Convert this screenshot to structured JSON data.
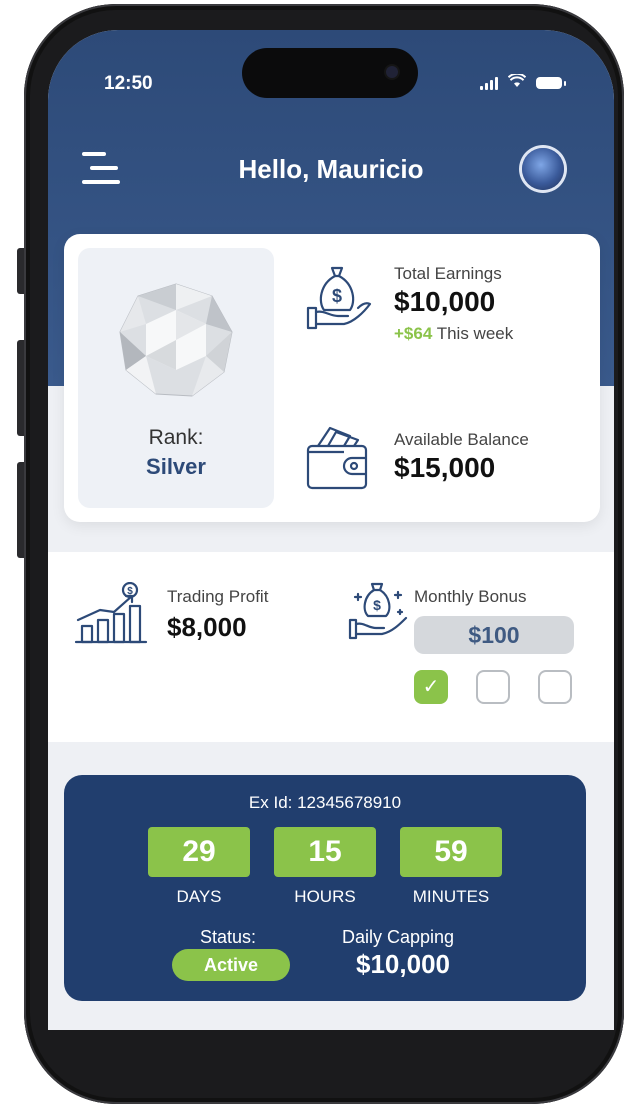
{
  "status_bar": {
    "time": "12:50"
  },
  "header": {
    "greeting": "Hello, Mauricio"
  },
  "rank": {
    "label": "Rank:",
    "value": "Silver"
  },
  "total_earnings": {
    "label": "Total Earnings",
    "value": "$10,000",
    "change": "+$64",
    "change_suffix": "This week"
  },
  "available_balance": {
    "label": "Available Balance",
    "value": "$15,000"
  },
  "trading_profit": {
    "label": "Trading Profit",
    "value": "$8,000"
  },
  "monthly_bonus": {
    "label": "Monthly Bonus",
    "value": "$100",
    "checkboxes": [
      true,
      false,
      false
    ]
  },
  "countdown": {
    "ex_id": "Ex Id: 12345678910",
    "days": "29",
    "days_label": "DAYS",
    "hours": "15",
    "hours_label": "HOURS",
    "minutes": "59",
    "minutes_label": "MINUTES"
  },
  "status": {
    "label": "Status:",
    "value": "Active"
  },
  "daily_capping": {
    "label": "Daily Capping",
    "value": "$10,000"
  },
  "colors": {
    "primary": "#2d4a78",
    "card_blue": "#213e6e",
    "accent_green": "#8bc34a"
  }
}
